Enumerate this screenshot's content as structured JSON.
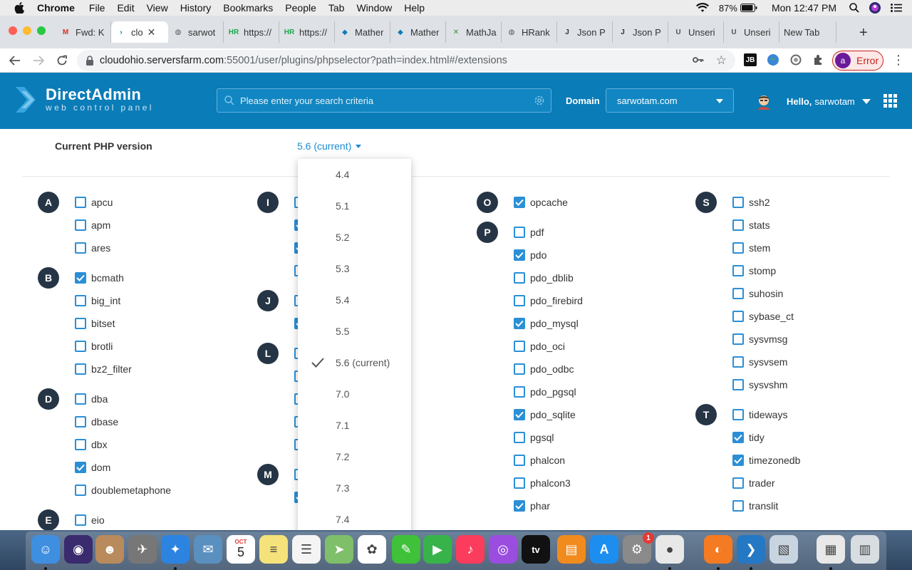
{
  "menubar": {
    "app": "Chrome",
    "items": [
      "File",
      "Edit",
      "View",
      "History",
      "Bookmarks",
      "People",
      "Tab",
      "Window",
      "Help"
    ],
    "battery": "87%",
    "clock": "Mon 12:47 PM"
  },
  "tabs": [
    {
      "title": "Fwd: K",
      "icon": "gmail-icon",
      "color": "#d93025"
    },
    {
      "title": "clo",
      "icon": "directadmin-icon",
      "color": "#0a7cb8",
      "active": true
    },
    {
      "title": "sarwot",
      "icon": "globe-icon",
      "color": "#555555"
    },
    {
      "title": "https://",
      "icon": "hackerrank-icon",
      "color": "#1ba94c"
    },
    {
      "title": "https://",
      "icon": "hackerrank-icon",
      "color": "#1ba94c"
    },
    {
      "title": "Mather",
      "icon": "mathworks-icon",
      "color": "#0a7cb8"
    },
    {
      "title": "Mather",
      "icon": "mathworks-icon",
      "color": "#0a7cb8"
    },
    {
      "title": "MathJa",
      "icon": "mathjax-icon",
      "color": "#3c8f3c"
    },
    {
      "title": "HRank",
      "icon": "globe-icon",
      "color": "#555555"
    },
    {
      "title": "Json P",
      "icon": "json-icon",
      "color": "#333333"
    },
    {
      "title": "Json P",
      "icon": "json-icon",
      "color": "#333333"
    },
    {
      "title": "Unseri",
      "icon": "u-icon",
      "color": "#555555"
    },
    {
      "title": "Unseri",
      "icon": "u-icon",
      "color": "#555555"
    },
    {
      "title": "New Tab",
      "icon": "",
      "color": "#555555"
    }
  ],
  "address": {
    "host": "cloudohio.serversfarm.com",
    "rest": ":55001/user/plugins/phpselector?path=index.html#/extensions"
  },
  "profile": {
    "initial": "a",
    "label": "Error"
  },
  "header": {
    "brand": "DirectAdmin",
    "tagline": "web control panel",
    "search_placeholder": "Please enter your search criteria",
    "domain_label": "Domain",
    "domain_value": "sarwotam.com",
    "hello": "Hello,",
    "username": "sarwotam"
  },
  "php": {
    "label": "Current PHP version",
    "current": "5.6 (current)"
  },
  "dropdown": {
    "options": [
      "4.4",
      "5.1",
      "5.2",
      "5.3",
      "5.4",
      "5.5",
      "5.6 (current)",
      "7.0",
      "7.1",
      "7.2",
      "7.3",
      "7.4"
    ],
    "selected_index": 6
  },
  "columns": [
    {
      "groups": [
        {
          "letter": "A",
          "items": [
            {
              "n": "apcu",
              "c": false
            },
            {
              "n": "apm",
              "c": false
            },
            {
              "n": "ares",
              "c": false
            }
          ]
        },
        {
          "letter": "B",
          "items": [
            {
              "n": "bcmath",
              "c": true
            },
            {
              "n": "big_int",
              "c": false
            },
            {
              "n": "bitset",
              "c": false
            },
            {
              "n": "brotli",
              "c": false
            },
            {
              "n": "bz2_filter",
              "c": false
            }
          ]
        },
        {
          "letter": "D",
          "items": [
            {
              "n": "dba",
              "c": false
            },
            {
              "n": "dbase",
              "c": false
            },
            {
              "n": "dbx",
              "c": false
            },
            {
              "n": "dom",
              "c": true
            },
            {
              "n": "doublemetaphone",
              "c": false
            }
          ]
        },
        {
          "letter": "E",
          "items": [
            {
              "n": "eio",
              "c": false
            }
          ]
        }
      ]
    },
    {
      "groups": [
        {
          "letter": "I",
          "items": [
            {
              "n": "",
              "c": false
            },
            {
              "n": "",
              "c": true
            },
            {
              "n": "",
              "c": true
            },
            {
              "n": "",
              "c": false
            }
          ]
        },
        {
          "letter": "J",
          "items": [
            {
              "n": "",
              "c": false
            },
            {
              "n": "",
              "c": true
            }
          ]
        },
        {
          "letter": "L",
          "items": [
            {
              "n": "",
              "c": false
            },
            {
              "n": "",
              "c": false
            },
            {
              "n": "",
              "c": false
            },
            {
              "n": "",
              "c": false
            },
            {
              "n": "",
              "c": false
            }
          ]
        },
        {
          "letter": "M",
          "items": [
            {
              "n": "",
              "c": false
            },
            {
              "n": "",
              "c": true
            }
          ]
        }
      ]
    },
    {
      "groups": [
        {
          "letter": "O",
          "items": [
            {
              "n": "opcache",
              "c": true
            }
          ]
        },
        {
          "letter": "P",
          "items": [
            {
              "n": "pdf",
              "c": false
            },
            {
              "n": "pdo",
              "c": true
            },
            {
              "n": "pdo_dblib",
              "c": false
            },
            {
              "n": "pdo_firebird",
              "c": false
            },
            {
              "n": "pdo_mysql",
              "c": true
            },
            {
              "n": "pdo_oci",
              "c": false
            },
            {
              "n": "pdo_odbc",
              "c": false
            },
            {
              "n": "pdo_pgsql",
              "c": false
            },
            {
              "n": "pdo_sqlite",
              "c": true
            },
            {
              "n": "pgsql",
              "c": false
            },
            {
              "n": "phalcon",
              "c": false
            },
            {
              "n": "phalcon3",
              "c": false
            },
            {
              "n": "phar",
              "c": true
            }
          ]
        }
      ]
    },
    {
      "groups": [
        {
          "letter": "S",
          "items": [
            {
              "n": "ssh2",
              "c": false
            },
            {
              "n": "stats",
              "c": false
            },
            {
              "n": "stem",
              "c": false
            },
            {
              "n": "stomp",
              "c": false
            },
            {
              "n": "suhosin",
              "c": false
            },
            {
              "n": "sybase_ct",
              "c": false
            },
            {
              "n": "sysvmsg",
              "c": false
            },
            {
              "n": "sysvsem",
              "c": false
            },
            {
              "n": "sysvshm",
              "c": false
            }
          ]
        },
        {
          "letter": "T",
          "items": [
            {
              "n": "tideways",
              "c": false
            },
            {
              "n": "tidy",
              "c": true
            },
            {
              "n": "timezonedb",
              "c": true
            },
            {
              "n": "trader",
              "c": false
            },
            {
              "n": "translit",
              "c": false
            }
          ]
        }
      ]
    }
  ],
  "dock": {
    "calendar_month": "OCT",
    "calendar_day": "5",
    "sysprefs_badge": "1",
    "tv_label": "tv",
    "apps": [
      "finder",
      "siri",
      "contacts",
      "launchpad",
      "safari",
      "mail",
      "calendar",
      "notes",
      "reminders",
      "maps",
      "photos",
      "messages",
      "facetime",
      "music",
      "podcasts",
      "tv",
      "books",
      "app-store",
      "system-preferences",
      "chrome",
      "firefox",
      "vscode",
      "preview",
      "db-browser",
      "trash"
    ]
  }
}
